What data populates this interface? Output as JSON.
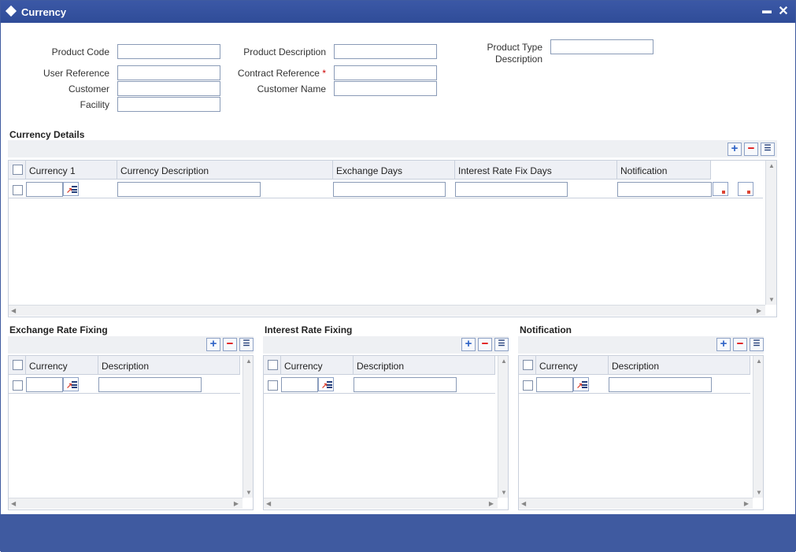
{
  "window": {
    "title": "Currency",
    "minimize_label": "▬",
    "close_label": "✕"
  },
  "form": {
    "product_code_label": "Product Code",
    "product_description_label": "Product Description",
    "product_type_description_label_line1": "Product Type",
    "product_type_description_label_line2": "Description",
    "user_reference_label": "User Reference",
    "contract_reference_label": "Contract Reference",
    "required_marker": "*",
    "customer_label": "Customer",
    "customer_name_label": "Customer Name",
    "facility_label": "Facility",
    "product_code_value": "",
    "product_description_value": "",
    "product_type_description_value": "",
    "user_reference_value": "",
    "contract_reference_value": "",
    "customer_value": "",
    "customer_name_value": "",
    "facility_value": ""
  },
  "currency_details": {
    "title": "Currency Details",
    "columns": [
      "Currency 1",
      "Currency Description",
      "Exchange Days",
      "Interest Rate Fix Days",
      "Notification"
    ],
    "rows": [
      {
        "currency": "",
        "description": "",
        "exchange_days": "",
        "interest_days": "",
        "notification": ""
      }
    ]
  },
  "exchange_rate_fixing": {
    "title": "Exchange Rate Fixing",
    "columns": [
      "Currency",
      "Description"
    ]
  },
  "interest_rate_fixing": {
    "title": "Interest Rate Fixing",
    "columns": [
      "Currency",
      "Description"
    ]
  },
  "notification": {
    "title": "Notification",
    "columns": [
      "Currency",
      "Description"
    ]
  },
  "toolbar": {
    "add_label": "+",
    "delete_label": "−",
    "list_label": "☰"
  },
  "icons": [
    "diamond-icon",
    "minimize-icon",
    "close-icon",
    "add-row-icon",
    "delete-row-icon",
    "list-view-icon",
    "lov-icon",
    "notification-detail-icon"
  ],
  "colors": {
    "titlebar": "#3b58a6",
    "footer": "#3f5aa0",
    "header_bg": "#eef0f5"
  }
}
